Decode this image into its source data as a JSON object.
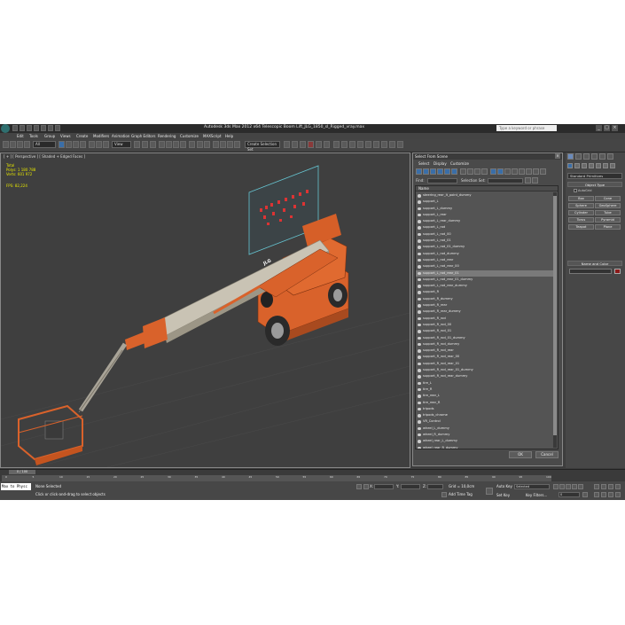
{
  "app": {
    "title": "Autodesk 3ds Max  2012 x64     Telescopic Boom Lift_JLG_1850_sl_Rigged_vray.max",
    "search_placeholder": "Type a keyword or phrase"
  },
  "menu": [
    "Edit",
    "Tools",
    "Group",
    "Views",
    "Create",
    "Modifiers",
    "Animation",
    "Graph Editors",
    "Rendering",
    "Customize",
    "MAXScript",
    "Help"
  ],
  "toolbar": {
    "filter_value": "All",
    "view_value": "View",
    "selection_set": "Create Selection Set"
  },
  "viewport": {
    "label": "[ + ] [ Perspective ] [ Shaded + Edged Faces ]",
    "stats": [
      {
        "label": "Total",
        "value": ""
      },
      {
        "label": "Polys:",
        "value": "1 180 788"
      },
      {
        "label": "Verts:",
        "value": "601 972"
      }
    ],
    "fps_label": "FPS:",
    "fps_value": "82,224",
    "model_brand": "JLG"
  },
  "dialog": {
    "title": "Select From Scene",
    "menu": [
      "Select",
      "Display",
      "Customize"
    ],
    "find_label": "Find:",
    "selection_set_label": "Selection Set:",
    "column_header": "Name",
    "items": [
      "steering_rear_lt_point_dummy",
      "support_L",
      "support_L_dummy",
      "support_L_rear",
      "support_L_rear_dummy",
      "support_L_rod",
      "support_L_rod_00",
      "support_L_rod_01",
      "support_L_rod_01_dummy",
      "support_L_rod_dummy",
      "support_L_rod_rear",
      "support_L_rod_rear_00",
      "support_L_rod_rear_01",
      "support_L_rod_rear_01_dummy",
      "support_L_rod_rear_dummy",
      "support_R",
      "support_R_dummy",
      "support_R_rear",
      "support_R_rear_dummy",
      "support_R_rod",
      "support_R_rod_00",
      "support_R_rod_01",
      "support_R_rod_01_dummy",
      "support_R_rod_dummy",
      "support_R_rod_rear",
      "support_R_rod_rear_00",
      "support_R_rod_rear_01",
      "support_R_rod_rear_01_dummy",
      "support_R_rod_rear_dummy",
      "tire_L",
      "tire_R",
      "tire_rear_L",
      "tire_rear_R",
      "tripods",
      "tripods_chrome",
      "VR_Control",
      "wheel_L_dummy",
      "wheel_R_dummy",
      "wheel_rear_L_dummy",
      "wheel_rear_R_dummy"
    ],
    "selected_index": 12,
    "ok_label": "OK",
    "cancel_label": "Cancel"
  },
  "command_panel": {
    "category_value": "Standard Primitives",
    "object_type_header": "Object Type",
    "autogrid_label": "AutoGrid",
    "objects": [
      "Box",
      "Cone",
      "Sphere",
      "GeoSphere",
      "Cylinder",
      "Tube",
      "Torus",
      "Pyramid",
      "Teapot",
      "Plane"
    ],
    "name_color_header": "Name and Color",
    "swatch_color": "#8b1a1a"
  },
  "timeline": {
    "frame_indicator": "0 / 100",
    "ticks": [
      "0",
      "5",
      "10",
      "15",
      "20",
      "25",
      "30",
      "35",
      "40",
      "45",
      "50",
      "55",
      "60",
      "65",
      "70",
      "75",
      "80",
      "85",
      "90",
      "95",
      "100"
    ]
  },
  "status": {
    "maxscript_text": "Max to Physc",
    "selection_text": "None Selected",
    "prompt_text": "Click or click-and-drag to select objects",
    "x_label": "X:",
    "y_label": "Y:",
    "z_label": "Z:",
    "grid_text": "Grid = 10,0cm",
    "auto_key_label": "Auto Key",
    "set_key_label": "Set Key",
    "selected_value": "Selected",
    "key_filters_label": "Key Filters...",
    "add_time_tag_label": "Add Time Tag",
    "frame_value": "0"
  },
  "colors": {
    "accent": "#3a6ea8",
    "stats_yellow": "#e6e600",
    "machine_orange": "#d9622b"
  }
}
